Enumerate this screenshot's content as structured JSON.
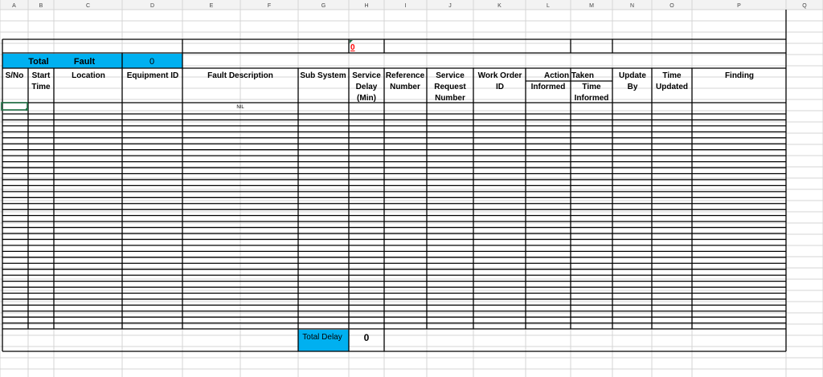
{
  "columns": [
    "A",
    "B",
    "C",
    "D",
    "E",
    "F",
    "G",
    "H",
    "I",
    "J",
    "K",
    "L",
    "M",
    "N",
    "O",
    "P",
    "Q"
  ],
  "header_row": {
    "total_label": "Total",
    "fault_label": "Fault",
    "fault_count": "0",
    "red_value": "0"
  },
  "table_headers": {
    "sno": "S/No",
    "start_time": [
      "Start",
      "Time"
    ],
    "location": "Location",
    "equipment_id": "Equipment ID",
    "fault_description": "Fault Description",
    "sub_system": "Sub System",
    "service_delay": [
      "Service",
      "Delay",
      "(Min)"
    ],
    "reference_number": [
      "Reference",
      "Number"
    ],
    "service_request_number": [
      "Service",
      "Request",
      "Number"
    ],
    "work_order_id": [
      "Work Order",
      "ID"
    ],
    "action_taken": "Action Taken",
    "informed": "Informed",
    "time_informed": [
      "Time",
      "Informed"
    ],
    "update_by": [
      "Update",
      "By"
    ],
    "time_updated": [
      "Time",
      "Updated"
    ],
    "finding": "Finding"
  },
  "first_row_fault_description": "NIL",
  "footer": {
    "total_delay_label": "Total Delay",
    "total_delay_value": "0"
  },
  "colors": {
    "highlight": "#00b0f0",
    "red": "#ff0000",
    "grid": "#d4d4d4",
    "header_bg": "#f3f3f3"
  }
}
